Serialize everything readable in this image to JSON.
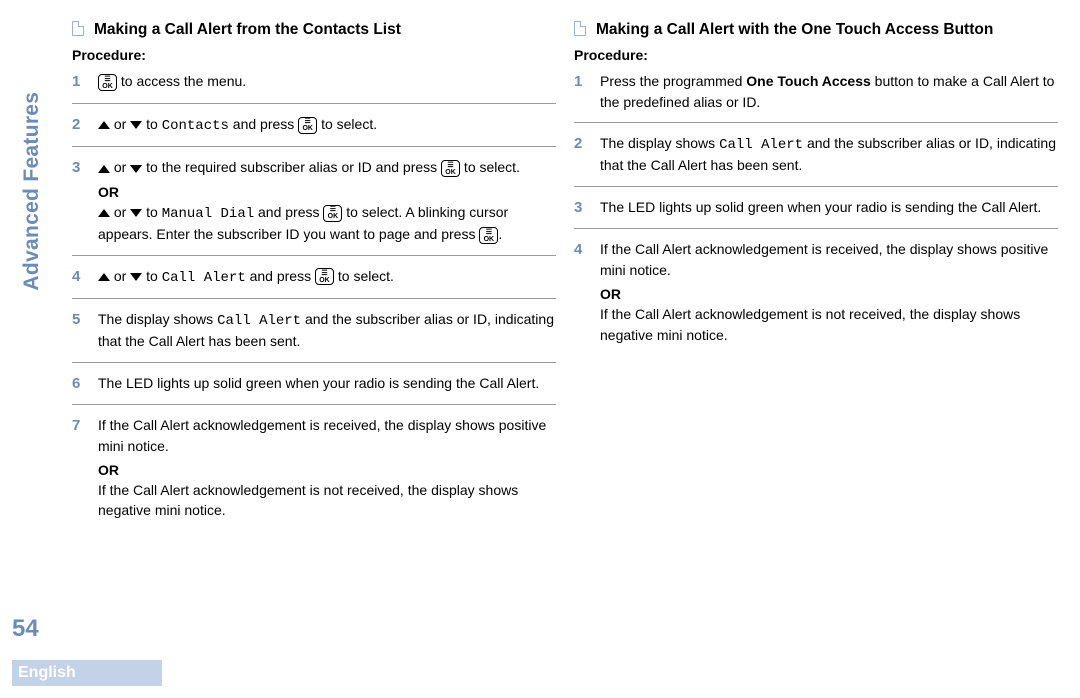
{
  "sidebar": "Advanced Features",
  "page_number": "54",
  "language": "English",
  "ok_label_top": "☰",
  "ok_label_bottom": "OK",
  "left": {
    "title": "Making a Call Alert from the Contacts List",
    "procedure_label": "Procedure:",
    "step1_b": " to access the menu.",
    "step2_a": " or ",
    "step2_b": " to ",
    "step2_c": "Contacts",
    "step2_d": " and press ",
    "step2_e": " to select.",
    "step3_a": " or ",
    "step3_b": " to the required subscriber alias or ID and press ",
    "step3_c": " to select.",
    "step3_or": "OR",
    "step3_d": " or ",
    "step3_e": " to ",
    "step3_f": "Manual Dial",
    "step3_g": " and press ",
    "step3_h": " to select. A blinking cursor appears. Enter the subscriber ID you want to page and press ",
    "step3_i": ".",
    "step4_a": " or ",
    "step4_b": " to ",
    "step4_c": "Call Alert",
    "step4_d": " and press ",
    "step4_e": " to select.",
    "step5_a": "The display shows ",
    "step5_b": "Call Alert",
    "step5_c": " and the subscriber alias or ID, indicating that the Call Alert has been sent.",
    "step6": "The LED lights up solid green when your radio is sending the Call Alert.",
    "step7_a": "If the Call Alert acknowledgement is received, the display shows positive mini notice.",
    "step7_or": "OR",
    "step7_b": "If the Call Alert acknowledgement is not received, the display shows negative mini notice."
  },
  "right": {
    "title": "Making a Call Alert with the One Touch Access Button",
    "procedure_label": "Procedure:",
    "step1_a": "Press the programmed ",
    "step1_b": "One Touch Access",
    "step1_c": " button to make a Call Alert to the predefined alias or ID.",
    "step2_a": "The display shows ",
    "step2_b": "Call Alert",
    "step2_c": " and the subscriber alias or ID, indicating that the Call Alert has been sent.",
    "step3": "The LED lights up solid green when your radio is sending the Call Alert.",
    "step4_a": "If the Call Alert acknowledgement is received, the display shows positive mini notice.",
    "step4_or": "OR",
    "step4_b": "If the Call Alert acknowledgement is not received, the display shows negative mini notice."
  }
}
